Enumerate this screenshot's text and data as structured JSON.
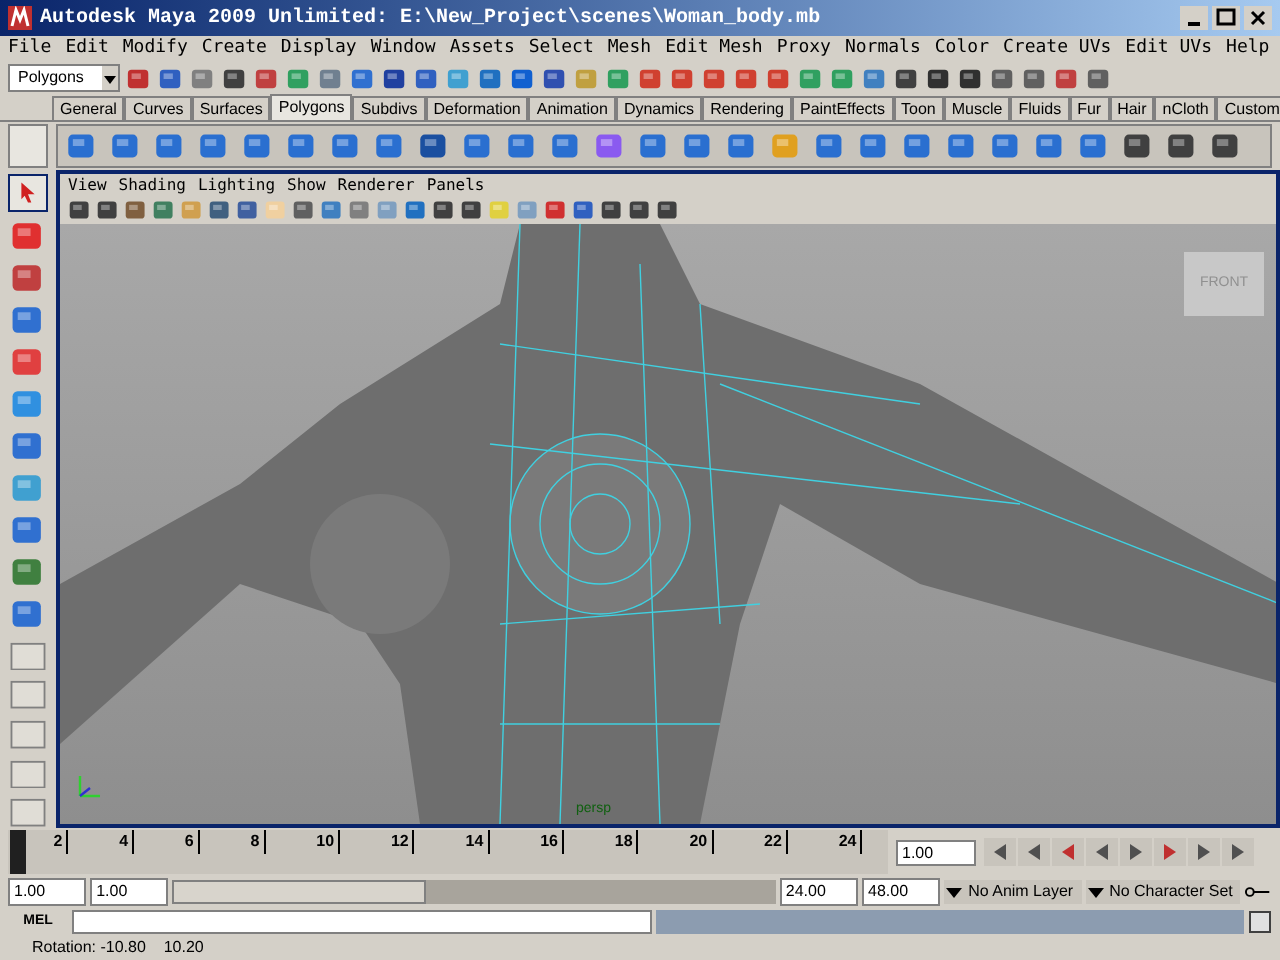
{
  "window": {
    "title": "Autodesk Maya 2009 Unlimited: E:\\New_Project\\scenes\\Woman_body.mb"
  },
  "menu": [
    "File",
    "Edit",
    "Modify",
    "Create",
    "Display",
    "Window",
    "Assets",
    "Select",
    "Mesh",
    "Edit Mesh",
    "Proxy",
    "Normals",
    "Color",
    "Create UVs",
    "Edit UVs",
    "Help"
  ],
  "menu_set": {
    "value": "Polygons"
  },
  "shelf_tabs": [
    {
      "label": "General",
      "selected": false
    },
    {
      "label": "Curves",
      "selected": false
    },
    {
      "label": "Surfaces",
      "selected": false
    },
    {
      "label": "Polygons",
      "selected": true
    },
    {
      "label": "Subdivs",
      "selected": false
    },
    {
      "label": "Deformation",
      "selected": false
    },
    {
      "label": "Animation",
      "selected": false
    },
    {
      "label": "Dynamics",
      "selected": false
    },
    {
      "label": "Rendering",
      "selected": false
    },
    {
      "label": "PaintEffects",
      "selected": false
    },
    {
      "label": "Toon",
      "selected": false
    },
    {
      "label": "Muscle",
      "selected": false
    },
    {
      "label": "Fluids",
      "selected": false
    },
    {
      "label": "Fur",
      "selected": false
    },
    {
      "label": "Hair",
      "selected": false
    },
    {
      "label": "nCloth",
      "selected": false
    },
    {
      "label": "Custom",
      "selected": false
    }
  ],
  "panel_menu": [
    "View",
    "Shading",
    "Lighting",
    "Show",
    "Renderer",
    "Panels"
  ],
  "viewport": {
    "camera": "persp",
    "view_cube": "FRONT"
  },
  "timeline": {
    "ticks": [
      "2",
      "4",
      "6",
      "8",
      "10",
      "12",
      "14",
      "16",
      "18",
      "20",
      "22",
      "24"
    ],
    "current_frame": "1.00",
    "level": 0
  },
  "range": {
    "start": "1.00",
    "playback_start": "1.00",
    "playback_end": "24.00",
    "level": 0.42,
    "end": "48.00",
    "anim_layer": "No Anim Layer",
    "character_set": "No Character Set"
  },
  "command_line": {
    "label": "MEL"
  },
  "help_line": {
    "text": "Rotation: -10.80    10.20"
  }
}
